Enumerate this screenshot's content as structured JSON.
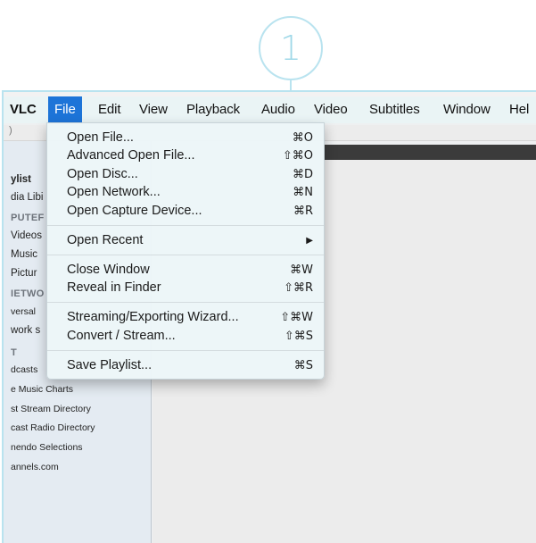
{
  "step": {
    "number": "1"
  },
  "menubar": {
    "items": [
      {
        "label": "VLC"
      },
      {
        "label": "File"
      },
      {
        "label": "Edit"
      },
      {
        "label": "View"
      },
      {
        "label": "Playback"
      },
      {
        "label": "Audio"
      },
      {
        "label": "Video"
      },
      {
        "label": "Subtitles"
      },
      {
        "label": "Window"
      },
      {
        "label": "Hel"
      }
    ]
  },
  "file_menu": {
    "items": [
      {
        "label": "Open File...",
        "shortcut": "⌘O"
      },
      {
        "label": "Advanced Open File...",
        "shortcut": "⇧⌘O"
      },
      {
        "label": "Open Disc...",
        "shortcut": "⌘D"
      },
      {
        "label": "Open Network...",
        "shortcut": "⌘N"
      },
      {
        "label": "Open Capture Device...",
        "shortcut": "⌘R"
      },
      {
        "label": "Open Recent",
        "shortcut": "▶"
      },
      {
        "label": "Close Window",
        "shortcut": "⌘W"
      },
      {
        "label": "Reveal in Finder",
        "shortcut": "⇧⌘R"
      },
      {
        "label": "Streaming/Exporting Wizard...",
        "shortcut": "⇧⌘W"
      },
      {
        "label": "Convert / Stream...",
        "shortcut": "⇧⌘S"
      },
      {
        "label": "Save Playlist...",
        "shortcut": "⌘S"
      }
    ]
  },
  "sidebar": {
    "top_fragment": ")",
    "items": [
      {
        "label": "ylist"
      },
      {
        "label": "dia Libi"
      },
      {
        "label": "PUTEF"
      },
      {
        "label": "Videos"
      },
      {
        "label": "Music"
      },
      {
        "label": "Pictur"
      },
      {
        "label": "IETWO"
      },
      {
        "label": "versal"
      },
      {
        "label": "work s"
      },
      {
        "label": "T"
      },
      {
        "label": "dcasts"
      },
      {
        "label": "e Music Charts"
      },
      {
        "label": "st Stream Directory"
      },
      {
        "label": "cast Radio Directory"
      },
      {
        "label": "nendo Selections"
      },
      {
        "label": "annels.com"
      }
    ]
  }
}
